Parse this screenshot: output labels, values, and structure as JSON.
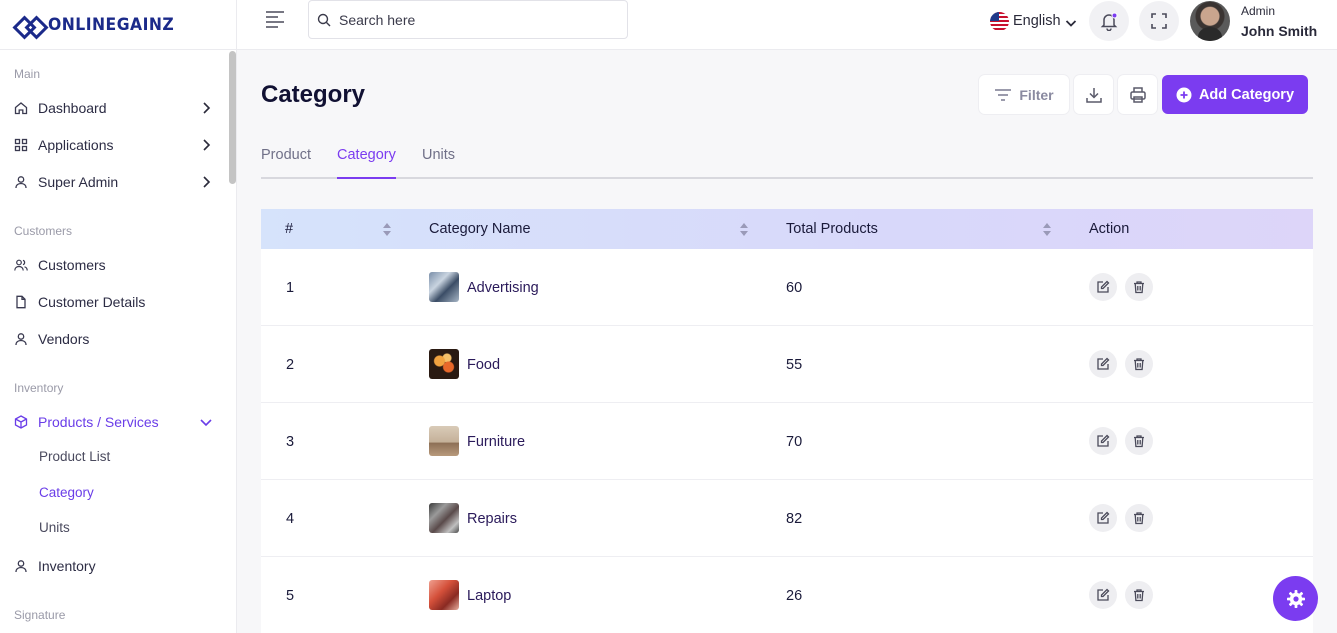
{
  "brand": {
    "name": "ONLINEGAINZ",
    "color": "#1b2a8a"
  },
  "accent": "#7b3cf0",
  "sidebar": {
    "sections": [
      {
        "title": "Main"
      },
      {
        "title": "Customers"
      },
      {
        "title": "Inventory"
      },
      {
        "title": "Signature"
      }
    ],
    "items": [
      {
        "label": "Dashboard",
        "icon": "home-icon"
      },
      {
        "label": "Applications",
        "icon": "grid-icon"
      },
      {
        "label": "Super Admin",
        "icon": "user-icon"
      },
      {
        "label": "Customers",
        "icon": "users-icon"
      },
      {
        "label": "Customer Details",
        "icon": "file-icon"
      },
      {
        "label": "Vendors",
        "icon": "user-icon"
      },
      {
        "label": "Products / Services",
        "icon": "box-icon"
      },
      {
        "label": "Inventory",
        "icon": "user-icon"
      }
    ],
    "subitems": [
      {
        "label": "Product List"
      },
      {
        "label": "Category"
      },
      {
        "label": "Units"
      }
    ]
  },
  "topbar": {
    "search_placeholder": "Search here",
    "language": "English",
    "user": {
      "role": "Admin",
      "name": "John Smith"
    }
  },
  "page": {
    "title": "Category",
    "filter_label": "Filter",
    "add_label": "Add Category",
    "tabs": [
      {
        "label": "Product"
      },
      {
        "label": "Category"
      },
      {
        "label": "Units"
      }
    ]
  },
  "table": {
    "headers": [
      "#",
      "Category Name",
      "Total Products",
      "Action"
    ],
    "rows": [
      {
        "num": "1",
        "name": "Advertising",
        "total": "60"
      },
      {
        "num": "2",
        "name": "Food",
        "total": "55"
      },
      {
        "num": "3",
        "name": "Furniture",
        "total": "70"
      },
      {
        "num": "4",
        "name": "Repairs",
        "total": "82"
      },
      {
        "num": "5",
        "name": "Laptop",
        "total": "26"
      }
    ]
  }
}
